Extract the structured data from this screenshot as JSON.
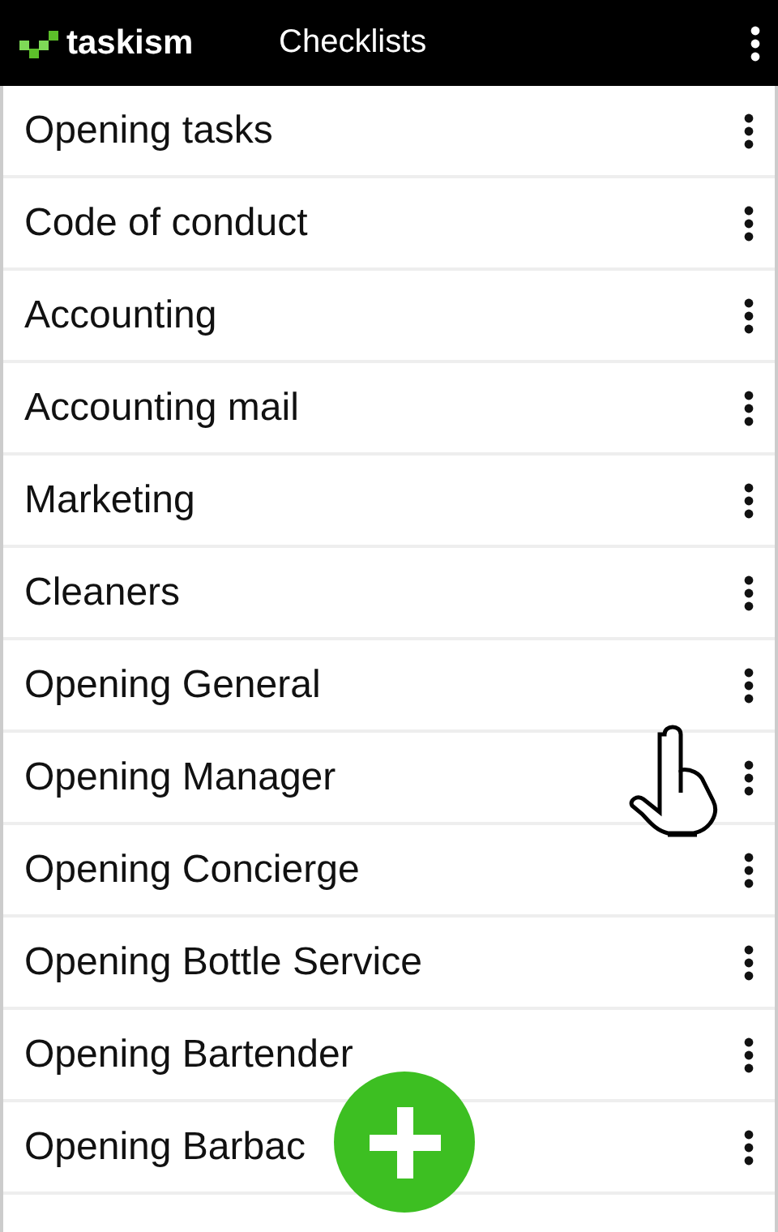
{
  "app_bar": {
    "logo_text": "taskism",
    "title": "Checklists"
  },
  "checklists": [
    {
      "name": "Opening tasks"
    },
    {
      "name": "Code of conduct"
    },
    {
      "name": "Accounting"
    },
    {
      "name": "Accounting mail"
    },
    {
      "name": "Marketing"
    },
    {
      "name": "Cleaners"
    },
    {
      "name": "Opening General"
    },
    {
      "name": "Opening Manager"
    },
    {
      "name": "Opening Concierge"
    },
    {
      "name": "Opening Bottle Service"
    },
    {
      "name": "Opening Bartender"
    },
    {
      "name": "Opening Barbac"
    }
  ]
}
